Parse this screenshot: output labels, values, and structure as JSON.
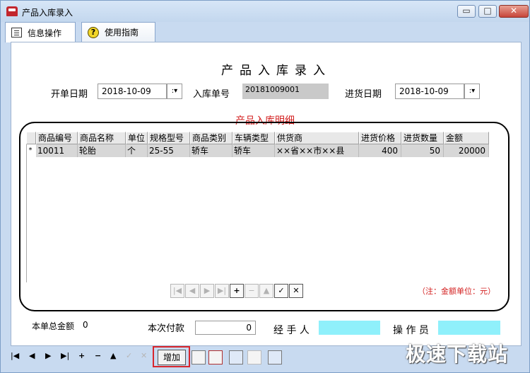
{
  "window": {
    "title": "产品入库录入",
    "min_label": "▭",
    "max_label": "□",
    "close_label": "✕"
  },
  "tabs": [
    {
      "label": "信息操作"
    },
    {
      "label": "使用指南"
    }
  ],
  "form": {
    "heading": "产品入库录入",
    "open_date_label": "开单日期",
    "open_date_value": "2018-10-09",
    "order_no_label": "入库单号",
    "order_no_value": "20181009001",
    "purchase_date_label": "进货日期",
    "purchase_date_value": "2018-10-09",
    "dropdown_glyph": ":▾"
  },
  "detail": {
    "title": "产品入库明细",
    "columns": [
      "商品编号",
      "商品名称",
      "单位",
      "规格型号",
      "商品类别",
      "车辆类型",
      "供货商",
      "进货价格",
      "进货数量",
      "金额"
    ],
    "rows": [
      {
        "marker": "*",
        "cells": [
          "10011",
          "轮胎",
          "个",
          "25-55",
          "轿车",
          "轿车",
          "××省××市××县",
          "400",
          "50",
          "20000"
        ]
      }
    ],
    "note": "（注：金额单位：元）"
  },
  "grid_nav": {
    "buttons": [
      "|◀",
      "◀",
      "▶",
      "▶|",
      "+",
      "−",
      "▲",
      "✓",
      "✕"
    ]
  },
  "footer": {
    "total_label": "本单总金额",
    "total_value": "0",
    "payment_label": "本次付款",
    "payment_value": "0",
    "handler_label": "经 手 人",
    "handler_value": "",
    "operator_label": "操 作 员",
    "operator_value": "",
    "accent_cyan": "#8ff0fb"
  },
  "toolbar": {
    "nav": [
      "|◀",
      "◀",
      "▶",
      "▶|",
      "+",
      "−",
      "▲",
      "✓",
      "✕"
    ],
    "add_label": "增加"
  },
  "watermark": "极速下载站"
}
